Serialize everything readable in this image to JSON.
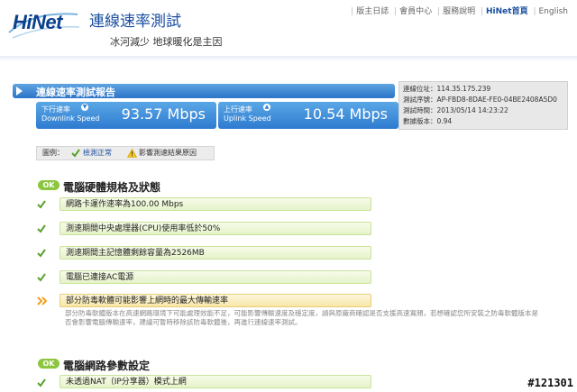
{
  "header": {
    "logo": "HiNet",
    "title": "連線速率測試",
    "slogan": "冰河減少 地球暖化是主因",
    "nav": [
      "版主日誌",
      "會員中心",
      "服務說明",
      "HiNet首頁",
      "English"
    ]
  },
  "report": {
    "title": "連線速率測試報告",
    "download": {
      "label_zh": "下行速率",
      "label_en": "Downlink Speed",
      "value": "93.57 Mbps"
    },
    "upload": {
      "label_zh": "上行速率",
      "label_en": "Uplink Speed",
      "value": "10.54 Mbps"
    }
  },
  "info": {
    "rows": [
      {
        "label": "連線位址：",
        "value": "114.35.175.239"
      },
      {
        "label": "測試序號：",
        "value": "AP-FBD8-8DAE-FE0-04BE2408A5D0"
      },
      {
        "label": "測試時間：",
        "value": "2013/05/14 14:23:22"
      },
      {
        "label": "數據版本：",
        "value": "0.94"
      }
    ]
  },
  "legend": {
    "label": "圖例：",
    "ok_text": "檢測正常",
    "warn_text": "影響測速結果原因"
  },
  "section1": {
    "tag": "OK",
    "title": "電腦硬體規格及狀態",
    "items": [
      "網路卡運作速率為100.00 Mbps",
      "測速期間中央處理器(CPU)使用率低於50%",
      "測速期間主記憶體剩餘容量為2526MB",
      "電腦已連接AC電源"
    ],
    "warning": "部分防毒軟體可能影響上網時的最大傳輸速率",
    "description": "部分防毒軟體版本在高速網路環境下可能處理效能不足，可能影響傳輸速度及穩定度，請與原廠商確認是否支援高速寬頻，若想確認您所安裝之防毒軟體版本是否會影響電腦傳輸速率，建議可暫時移除該防毒軟體後，再進行連線速率測試。"
  },
  "section2": {
    "tag": "OK",
    "title": "電腦網路參數設定",
    "items": [
      "未透過NAT（IP分享器）模式上網"
    ]
  },
  "watermark": "#121301",
  "colors": {
    "accent_blue": "#2e7bd0",
    "ok_green": "#8cc63f",
    "warn_orange": "#f0a020"
  }
}
